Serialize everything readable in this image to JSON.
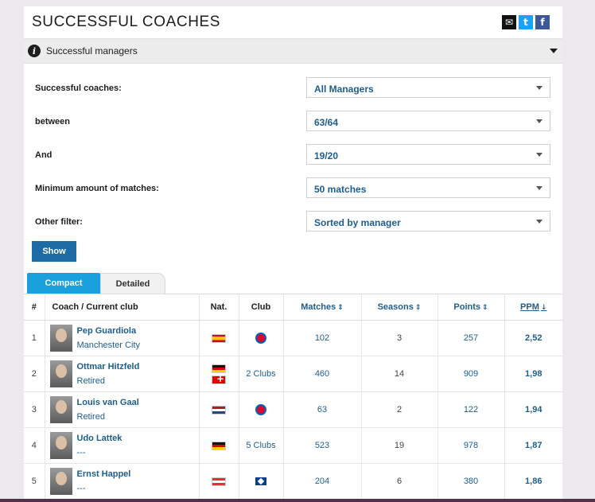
{
  "header": {
    "title": "SUCCESSFUL COACHES",
    "share_icons": [
      "mail-icon",
      "twitter-icon",
      "facebook-icon"
    ]
  },
  "info": {
    "label": "Successful managers"
  },
  "filters": [
    {
      "label": "Successful coaches:",
      "value": "All Managers"
    },
    {
      "label": "between",
      "value": "63/64"
    },
    {
      "label": "And",
      "value": "19/20"
    },
    {
      "label": "Minimum amount of matches:",
      "value": "50 matches"
    },
    {
      "label": "Other filter:",
      "value": "Sorted by manager"
    }
  ],
  "show_label": "Show",
  "tabs": {
    "compact": "Compact",
    "detailed": "Detailed"
  },
  "columns": {
    "rank": "#",
    "coach": "Coach / Current club",
    "nat": "Nat.",
    "club": "Club",
    "matches": "Matches",
    "seasons": "Seasons",
    "points": "Points",
    "ppm": "PPM"
  },
  "rows": [
    {
      "rank": "1",
      "name": "Pep Guardiola",
      "current_club": "Manchester City",
      "nat": [
        "es"
      ],
      "club": "",
      "club_icon": "bayern-badge-icon",
      "matches": "102",
      "seasons": "3",
      "points": "257",
      "ppm": "2,52"
    },
    {
      "rank": "2",
      "name": "Ottmar Hitzfeld",
      "current_club": "Retired",
      "nat": [
        "de",
        "ch"
      ],
      "club": "2 Clubs",
      "club_icon": "",
      "matches": "460",
      "seasons": "14",
      "points": "909",
      "ppm": "1,98"
    },
    {
      "rank": "3",
      "name": "Louis van Gaal",
      "current_club": "Retired",
      "nat": [
        "nl"
      ],
      "club": "",
      "club_icon": "bayern-badge-icon",
      "matches": "63",
      "seasons": "2",
      "points": "122",
      "ppm": "1,94"
    },
    {
      "rank": "4",
      "name": "Udo Lattek",
      "current_club": "---",
      "nat": [
        "de"
      ],
      "club": "5 Clubs",
      "club_icon": "",
      "matches": "523",
      "seasons": "19",
      "points": "978",
      "ppm": "1,87"
    },
    {
      "rank": "5",
      "name": "Ernst Happel",
      "current_club": "---",
      "nat": [
        "at"
      ],
      "club": "",
      "club_icon": "hsv-badge-icon",
      "matches": "204",
      "seasons": "6",
      "points": "380",
      "ppm": "1,86"
    }
  ]
}
